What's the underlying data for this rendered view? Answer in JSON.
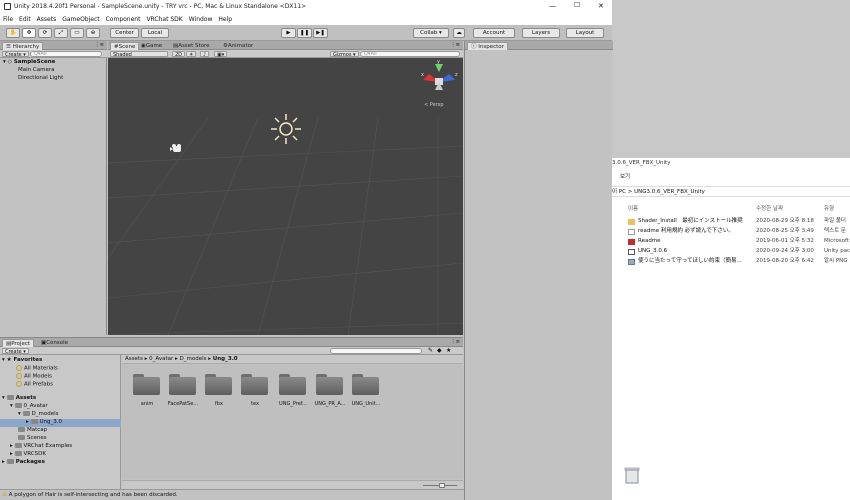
{
  "window": {
    "title": "Unity 2018.4.20f1 Personal - SampleScene.unity - TRY vrc - PC, Mac & Linux Standalone <DX11>",
    "controls": [
      "—",
      "☐",
      "✕"
    ]
  },
  "menu": [
    "File",
    "Edit",
    "Assets",
    "GameObject",
    "Component",
    "VRChat SDK",
    "Window",
    "Help"
  ],
  "toolbar": {
    "pivot": "Center",
    "space": "Local",
    "collab": "Collab ▾",
    "account": "Account",
    "layers": "Layers",
    "layout": "Layout"
  },
  "hierarchy": {
    "tab": "Hierarchy",
    "create": "Create ▾",
    "search_placeholder": "Q▾All",
    "scene": "SampleScene",
    "items": [
      "Main Camera",
      "Directional Light"
    ]
  },
  "scene_view": {
    "tabs": [
      "Scene",
      "Game",
      "Asset Store",
      "Animator"
    ],
    "shading": "Shaded",
    "mode": "2D",
    "gizmos": "Gizmos ▾",
    "search_placeholder": "Q▾All",
    "persp": "< Persp",
    "axes": [
      "y",
      "x",
      "z"
    ]
  },
  "inspector": {
    "tab": "Inspector"
  },
  "project": {
    "tabs": [
      "Project",
      "Console"
    ],
    "create": "Create ▾",
    "breadcrumb": [
      "Assets",
      "0_Avatar",
      "D_models",
      "Ung_3.0"
    ],
    "favorites": {
      "label": "Favorites",
      "items": [
        "All Materials",
        "All Models",
        "All Prefabs"
      ]
    },
    "assets_tree": {
      "label": "Assets",
      "items": [
        "0_Avatar",
        "D_models",
        "Ung_3.0",
        "Matcap",
        "Scenes",
        "VRChat Examples",
        "VRCSDK"
      ]
    },
    "packages": "Packages",
    "folders": [
      "anim",
      "FacePatSe...",
      "fbx",
      "tex",
      "UNG_Pref...",
      "UNG_PR_A...",
      "UNG_Unit..."
    ]
  },
  "status": {
    "message": "A polygon of Hair is self-intersecting and has been discarded."
  },
  "explorer": {
    "title": "3.0.6_VER_FBX_Unity",
    "ribbon": "보기",
    "address_prefix": "이 PC",
    "address": "UNG3.0.6_VER_FBX_Unity",
    "columns": [
      "이름",
      "수정한 날짜",
      "유형"
    ],
    "rows": [
      {
        "name": "Shader_Install　最初にインストール推奨",
        "date": "2020-08-29 오후 8:18",
        "type": "파일 폴더",
        "icon": "folder-icon"
      },
      {
        "name": "readme 利用規約 必ず読んで下さい。",
        "date": "2020-08-25 오후 3:49",
        "type": "텍스트 문",
        "icon": "text-file-icon"
      },
      {
        "name": "Readme",
        "date": "2019-06-01 오후 5:32",
        "type": "Microsoft",
        "icon": "pdf-icon"
      },
      {
        "name": "UNG_3.0.6",
        "date": "2020-09-24 오후 3:00",
        "type": "Unity pac",
        "icon": "unity-package-icon"
      },
      {
        "name": "使うに当たって守ってほしい約束（簡易...",
        "date": "2019-08-20 오후 6:42",
        "type": "알씨 PNG",
        "icon": "image-file-icon"
      }
    ]
  }
}
